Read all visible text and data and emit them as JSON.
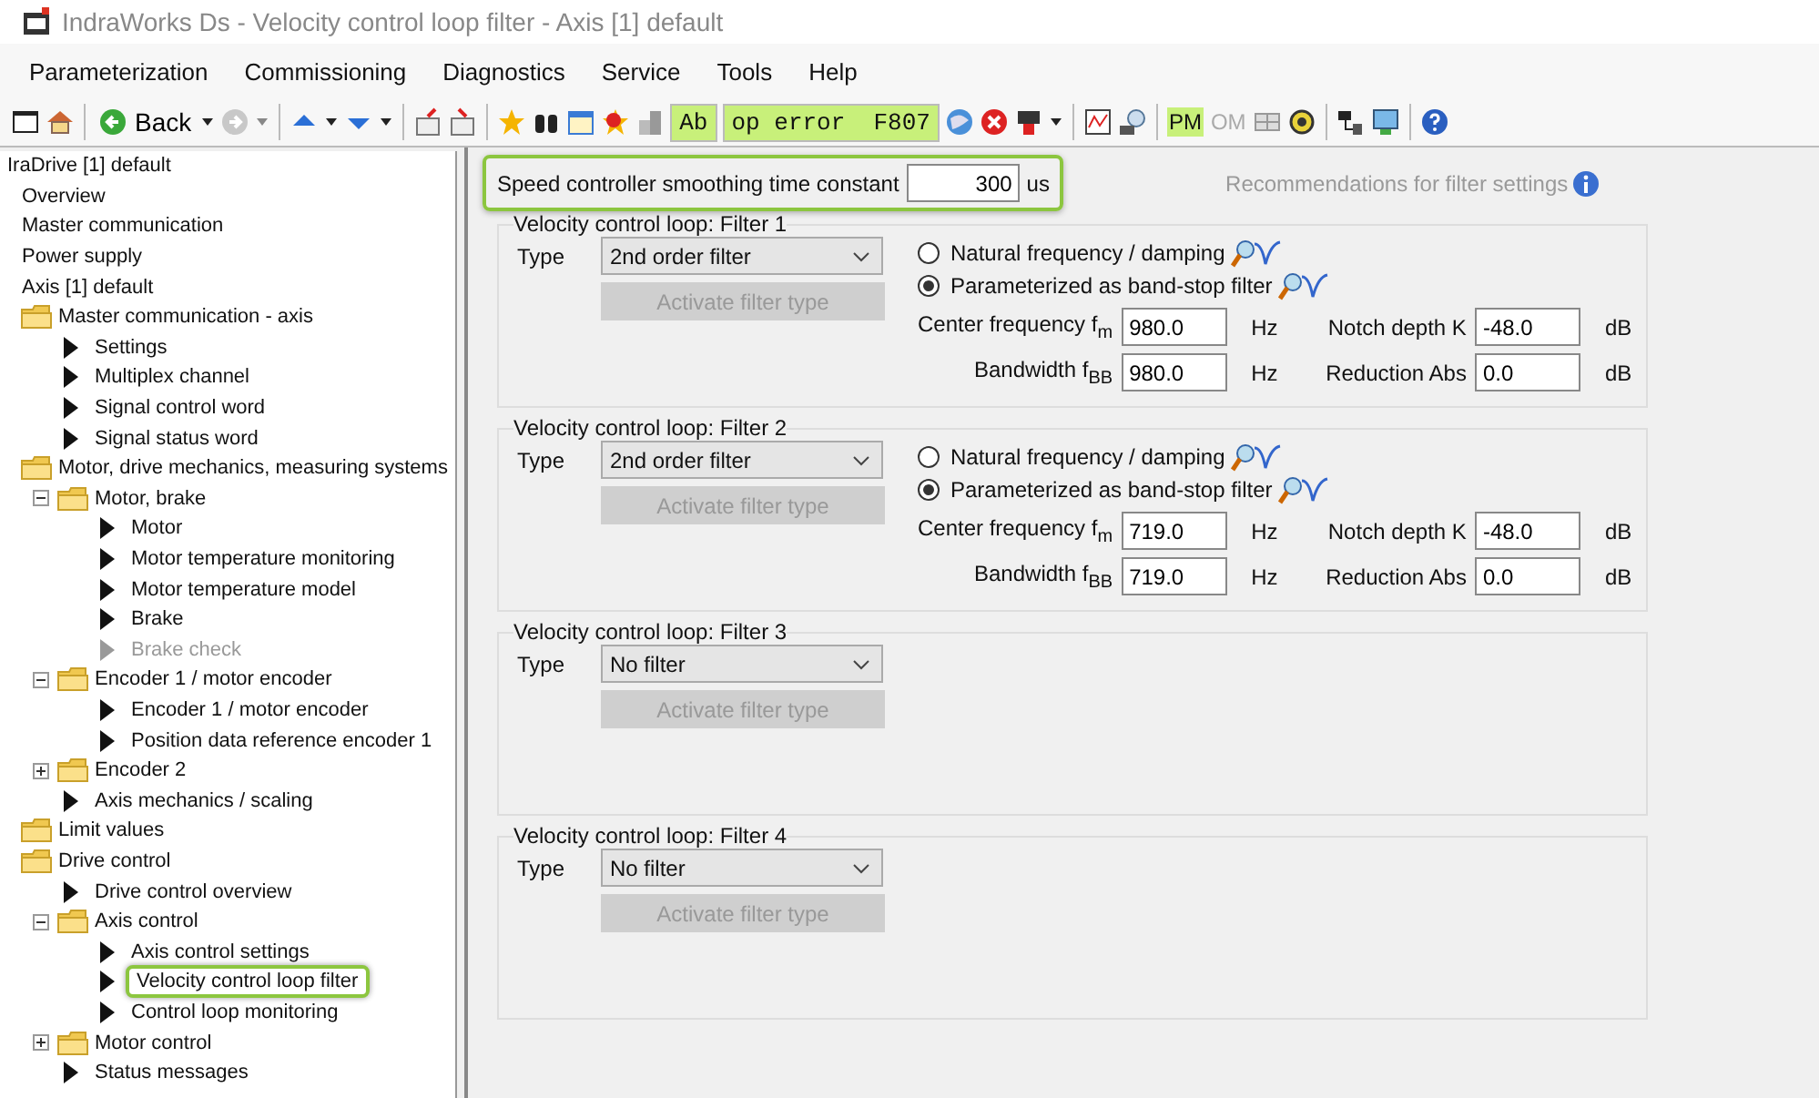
{
  "window": {
    "title": "IndraWorks Ds - Velocity control loop filter - Axis [1] default"
  },
  "menu": [
    "Parameterization",
    "Commissioning",
    "Diagnostics",
    "Service",
    "Tools",
    "Help"
  ],
  "toolbar": {
    "back_label": "Back",
    "status_ab": "Ab",
    "error_text": "op error  F807",
    "mode_pm": {
      "label": "PM",
      "disabled": false
    },
    "mode_om": {
      "label": "OM",
      "disabled": true
    }
  },
  "tree": {
    "items": [
      {
        "label": "IraDrive [1] default",
        "kind": "node",
        "selected": false,
        "disabled": false,
        "children": [
          {
            "label": "Overview",
            "kind": "node",
            "selected": false,
            "disabled": false
          },
          {
            "label": "Master communication",
            "kind": "node",
            "selected": false,
            "disabled": false
          },
          {
            "label": "Power supply",
            "kind": "node",
            "selected": false,
            "disabled": false
          },
          {
            "label": "Axis [1] default",
            "kind": "node",
            "selected": false,
            "disabled": false,
            "children": [
              {
                "label": "Master communication - axis",
                "kind": "folder",
                "selected": false,
                "disabled": false,
                "children": [
                  {
                    "label": "Settings",
                    "kind": "page",
                    "selected": false,
                    "disabled": false
                  },
                  {
                    "label": "Multiplex channel",
                    "kind": "page",
                    "selected": false,
                    "disabled": false
                  },
                  {
                    "label": "Signal control word",
                    "kind": "page",
                    "selected": false,
                    "disabled": false
                  },
                  {
                    "label": "Signal status word",
                    "kind": "page",
                    "selected": false,
                    "disabled": false
                  }
                ]
              },
              {
                "label": "Motor, drive mechanics, measuring systems",
                "kind": "folder",
                "selected": false,
                "disabled": false,
                "children": [
                  {
                    "label": "Motor, brake",
                    "kind": "folder",
                    "expanded": true,
                    "selected": false,
                    "disabled": false,
                    "children": [
                      {
                        "label": "Motor",
                        "kind": "page",
                        "selected": false,
                        "disabled": false
                      },
                      {
                        "label": "Motor temperature monitoring",
                        "kind": "page",
                        "selected": false,
                        "disabled": false
                      },
                      {
                        "label": "Motor temperature model",
                        "kind": "page",
                        "selected": false,
                        "disabled": false
                      },
                      {
                        "label": "Brake",
                        "kind": "page",
                        "selected": false,
                        "disabled": false
                      },
                      {
                        "label": "Brake check",
                        "kind": "page",
                        "selected": false,
                        "disabled": true
                      }
                    ]
                  },
                  {
                    "label": "Encoder 1 / motor encoder",
                    "kind": "folder",
                    "expanded": true,
                    "selected": false,
                    "disabled": false,
                    "children": [
                      {
                        "label": "Encoder 1 / motor encoder",
                        "kind": "page",
                        "selected": false,
                        "disabled": false
                      },
                      {
                        "label": "Position data reference encoder 1",
                        "kind": "page",
                        "selected": false,
                        "disabled": false
                      }
                    ]
                  },
                  {
                    "label": "Encoder 2",
                    "kind": "folder",
                    "expanded": false,
                    "selected": false,
                    "disabled": false
                  },
                  {
                    "label": "Axis mechanics / scaling",
                    "kind": "page",
                    "selected": false,
                    "disabled": false
                  }
                ]
              },
              {
                "label": "Limit values",
                "kind": "folder",
                "selected": false,
                "disabled": false
              },
              {
                "label": "Drive control",
                "kind": "folder",
                "selected": false,
                "disabled": false,
                "children": [
                  {
                    "label": "Drive control overview",
                    "kind": "page",
                    "selected": false,
                    "disabled": false
                  },
                  {
                    "label": "Axis control",
                    "kind": "folder",
                    "expanded": true,
                    "selected": false,
                    "disabled": false,
                    "children": [
                      {
                        "label": "Axis control settings",
                        "kind": "page",
                        "selected": false,
                        "disabled": false
                      },
                      {
                        "label": "Velocity control loop filter",
                        "kind": "page",
                        "selected": true,
                        "disabled": false
                      },
                      {
                        "label": "Control loop monitoring",
                        "kind": "page",
                        "selected": false,
                        "disabled": false
                      }
                    ]
                  },
                  {
                    "label": "Motor control",
                    "kind": "folder",
                    "expanded": false,
                    "selected": false,
                    "disabled": false
                  },
                  {
                    "label": "Status messages",
                    "kind": "page",
                    "selected": false,
                    "disabled": false
                  }
                ]
              }
            ]
          }
        ]
      }
    ]
  },
  "smoothing": {
    "label": "Speed controller smoothing time constant",
    "value": "300",
    "unit": "us",
    "highlighted": true
  },
  "recommendations": {
    "label": "Recommendations for filter settings"
  },
  "filters": [
    {
      "title": "Velocity control loop: Filter 1",
      "type_label": "Type",
      "type_value": "2nd order filter",
      "activate": {
        "label": "Activate filter type",
        "disabled": true
      },
      "modes": [
        {
          "label": "Natural frequency / damping",
          "selected": false
        },
        {
          "label": "Parameterized as band-stop filter",
          "selected": true
        }
      ],
      "params": [
        {
          "label": "Center frequency f$_{m}$",
          "value": "980.0",
          "unit": "Hz"
        },
        {
          "label": "Notch depth K",
          "value": "-48.0",
          "unit": "dB"
        },
        {
          "label": "Bandwidth f$_{BB}$",
          "value": "980.0",
          "unit": "Hz"
        },
        {
          "label": "Reduction Abs",
          "value": "0.0",
          "unit": "dB"
        }
      ]
    },
    {
      "title": "Velocity control loop: Filter 2",
      "type_label": "Type",
      "type_value": "2nd order filter",
      "activate": {
        "label": "Activate filter type",
        "disabled": true
      },
      "modes": [
        {
          "label": "Natural frequency / damping",
          "selected": false
        },
        {
          "label": "Parameterized as band-stop filter",
          "selected": true
        }
      ],
      "params": [
        {
          "label": "Center frequency f$_{m}$",
          "value": "719.0",
          "unit": "Hz"
        },
        {
          "label": "Notch depth K",
          "value": "-48.0",
          "unit": "dB"
        },
        {
          "label": "Bandwidth f$_{BB}$",
          "value": "719.0",
          "unit": "Hz"
        },
        {
          "label": "Reduction Abs",
          "value": "0.0",
          "unit": "dB"
        }
      ]
    },
    {
      "title": "Velocity control loop: Filter 3",
      "type_label": "Type",
      "type_value": "No filter",
      "activate": {
        "label": "Activate filter type",
        "disabled": true
      }
    },
    {
      "title": "Velocity control loop: Filter 4",
      "type_label": "Type",
      "type_value": "No filter",
      "activate": {
        "label": "Activate filter type",
        "disabled": true
      }
    }
  ]
}
